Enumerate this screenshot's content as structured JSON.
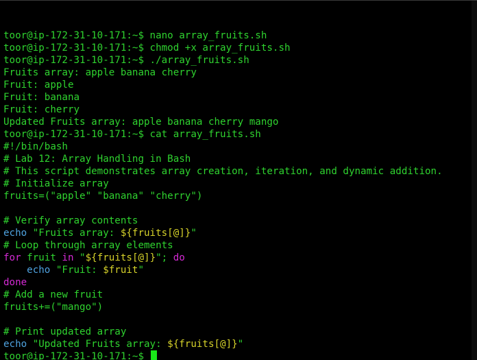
{
  "colors": {
    "background": "#000000",
    "green": "#2fd32f",
    "blue": "#4fa3e0",
    "magenta": "#d52ad5",
    "yellow": "#d6d22a",
    "cursor": "#19e619"
  },
  "terminal": {
    "lines": [
      [
        {
          "text": "toor@ip-172-31-10-171:~$ nano array_fruits.sh",
          "color": "green"
        }
      ],
      [
        {
          "text": "toor@ip-172-31-10-171:~$ chmod +x array_fruits.sh",
          "color": "green"
        }
      ],
      [
        {
          "text": "toor@ip-172-31-10-171:~$ ./array_fruits.sh",
          "color": "green"
        }
      ],
      [
        {
          "text": "Fruits array: apple banana cherry",
          "color": "green"
        }
      ],
      [
        {
          "text": "Fruit: apple",
          "color": "green"
        }
      ],
      [
        {
          "text": "Fruit: banana",
          "color": "green"
        }
      ],
      [
        {
          "text": "Fruit: cherry",
          "color": "green"
        }
      ],
      [
        {
          "text": "Updated Fruits array: apple banana cherry mango",
          "color": "green"
        }
      ],
      [
        {
          "text": "toor@ip-172-31-10-171:~$ cat array_fruits.sh",
          "color": "green"
        }
      ],
      [
        {
          "text": "#!/bin/bash",
          "color": "green"
        }
      ],
      [
        {
          "text": "# Lab 12: Array Handling in Bash",
          "color": "green"
        }
      ],
      [
        {
          "text": "# This script demonstrates array creation, iteration, and dynamic addition.",
          "color": "green"
        }
      ],
      [
        {
          "text": "# Initialize array",
          "color": "green"
        }
      ],
      [
        {
          "text": "fruits=(\"apple\" \"banana\" \"cherry\")",
          "color": "green"
        }
      ],
      [],
      [
        {
          "text": "# Verify array contents",
          "color": "green"
        }
      ],
      [
        {
          "text": "echo",
          "color": "blue"
        },
        {
          "text": " \"Fruits array: ",
          "color": "green"
        },
        {
          "text": "${fruits[@]}",
          "color": "yellow"
        },
        {
          "text": "\"",
          "color": "green"
        }
      ],
      [
        {
          "text": "# Loop through array elements",
          "color": "green"
        }
      ],
      [
        {
          "text": "for",
          "color": "magenta"
        },
        {
          "text": " fruit ",
          "color": "green"
        },
        {
          "text": "in",
          "color": "magenta"
        },
        {
          "text": " \"",
          "color": "green"
        },
        {
          "text": "${fruits[@]}",
          "color": "yellow"
        },
        {
          "text": "\"; ",
          "color": "green"
        },
        {
          "text": "do",
          "color": "magenta"
        }
      ],
      [
        {
          "text": "    ",
          "color": "green"
        },
        {
          "text": "echo",
          "color": "blue"
        },
        {
          "text": " \"Fruit: ",
          "color": "green"
        },
        {
          "text": "$fruit",
          "color": "yellow"
        },
        {
          "text": "\"",
          "color": "green"
        }
      ],
      [
        {
          "text": "done",
          "color": "magenta"
        }
      ],
      [
        {
          "text": "# Add a new fruit",
          "color": "green"
        }
      ],
      [
        {
          "text": "fruits+=(\"mango\")",
          "color": "green"
        }
      ],
      [],
      [
        {
          "text": "# Print updated array",
          "color": "green"
        }
      ],
      [
        {
          "text": "echo",
          "color": "blue"
        },
        {
          "text": " \"Updated Fruits array: ",
          "color": "green"
        },
        {
          "text": "${fruits[@]}",
          "color": "yellow"
        },
        {
          "text": "\"",
          "color": "green"
        }
      ],
      [
        {
          "text": "toor@ip-172-31-10-171:~$ ",
          "color": "green"
        }
      ]
    ],
    "cursor_line": 26
  }
}
